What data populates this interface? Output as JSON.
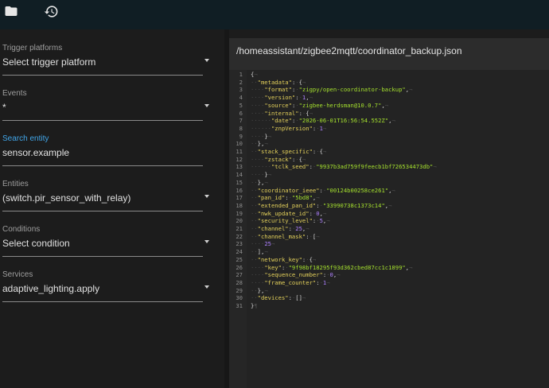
{
  "topbar": {
    "icons": [
      "folder-icon",
      "history-icon"
    ]
  },
  "sidebar": {
    "fields": [
      {
        "id": "trigger-platforms",
        "label": "Trigger platforms",
        "value": "Select trigger platform",
        "dropdown": true,
        "active": false
      },
      {
        "id": "events",
        "label": "Events",
        "value": "*",
        "dropdown": true,
        "active": false
      },
      {
        "id": "search-entity",
        "label": "Search entity",
        "value": "sensor.example",
        "dropdown": false,
        "active": true
      },
      {
        "id": "entities",
        "label": "Entities",
        "value": " (switch.pir_sensor_with_relay)",
        "dropdown": true,
        "active": false
      },
      {
        "id": "conditions",
        "label": "Conditions",
        "value": "Select condition",
        "dropdown": true,
        "active": false
      },
      {
        "id": "services",
        "label": "Services",
        "value": "adaptive_lighting.apply",
        "dropdown": true,
        "active": false
      }
    ]
  },
  "file": {
    "path": "/homeassistant/zigbee2mqtt/coordinator_backup.json"
  },
  "editor": {
    "lines": [
      "{¬",
      "··\"metadata\":·{¬",
      "····\"format\":·\"zigpy/open-coordinator-backup\",¬",
      "····\"version\":·1,¬",
      "····\"source\":·\"zigbee-herdsman@10.0.7\",¬",
      "····\"internal\":·{¬",
      "······\"date\":·\"2026-06-01T16:56:54.552Z\",¬",
      "······\"znpVersion\":·1¬",
      "····}¬",
      "··},¬",
      "··\"stack_specific\":·{¬",
      "····\"zstack\":·{¬",
      "······\"tclk_seed\":·\"9937b3ad759f9feecb1bf726534473db\"¬",
      "····}¬",
      "··},¬",
      "··\"coordinator_ieee\":·\"00124b00258ce261\",¬",
      "··\"pan_id\":·\"5bd8\",¬",
      "··\"extended_pan_id\":·\"33990738c1373c14\",¬",
      "··\"nwk_update_id\":·0,¬",
      "··\"security_level\":·5,¬",
      "··\"channel\":·25,¬",
      "··\"channel_mask\":·[¬",
      "····25¬",
      "··],¬",
      "··\"network_key\":·{¬",
      "····\"key\":·\"9f98bf18295f93d362cbed87cc1c1899\",¬",
      "····\"sequence_number\":·0,¬",
      "····\"frame_counter\":·1¬",
      "··},¬",
      "··\"devices\":·[]¬",
      "}¶"
    ]
  }
}
